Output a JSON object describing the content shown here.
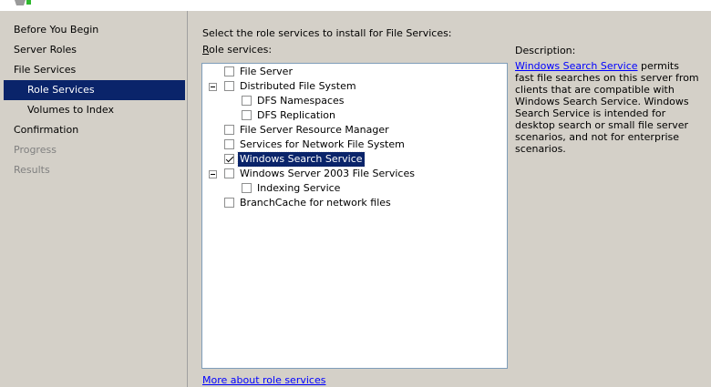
{
  "nav": {
    "items": [
      {
        "label": "Before You Begin",
        "state": "normal"
      },
      {
        "label": "Server Roles",
        "state": "normal"
      },
      {
        "label": "File Services",
        "state": "normal"
      },
      {
        "label": "Role Services",
        "state": "selected"
      },
      {
        "label": "Volumes to Index",
        "state": "normal"
      },
      {
        "label": "Confirmation",
        "state": "normal"
      },
      {
        "label": "Progress",
        "state": "disabled"
      },
      {
        "label": "Results",
        "state": "disabled"
      }
    ]
  },
  "main": {
    "instructions": "Select the role services to install for File Services:",
    "role_services_label_accel": "R",
    "role_services_label_rest": "ole services:",
    "tree": [
      {
        "label": "File Server",
        "checked": false,
        "expander": false,
        "level": 0
      },
      {
        "label": "Distributed File System",
        "checked": false,
        "expander": true,
        "level": 0
      },
      {
        "label": "DFS Namespaces",
        "checked": false,
        "expander": false,
        "level": 1
      },
      {
        "label": "DFS Replication",
        "checked": false,
        "expander": false,
        "level": 1
      },
      {
        "label": "File Server Resource Manager",
        "checked": false,
        "expander": false,
        "level": 0
      },
      {
        "label": "Services for Network File System",
        "checked": false,
        "expander": false,
        "level": 0
      },
      {
        "label": "Windows Search Service",
        "checked": true,
        "expander": false,
        "level": 0,
        "selected": true
      },
      {
        "label": "Windows Server 2003 File Services",
        "checked": false,
        "expander": true,
        "level": 0
      },
      {
        "label": "Indexing Service",
        "checked": false,
        "expander": false,
        "level": 1
      },
      {
        "label": "BranchCache for network files",
        "checked": false,
        "expander": false,
        "level": 0
      }
    ],
    "more_link": "More about role services"
  },
  "description": {
    "heading": "Description:",
    "link": "Windows Search Service",
    "text_line1": " permits fast",
    "text_rest": "file searches on this server from clients that are compatible with Windows Search Service. Windows Search Service is intended for desktop search or small file server scenarios, and not for enterprise scenarios."
  }
}
